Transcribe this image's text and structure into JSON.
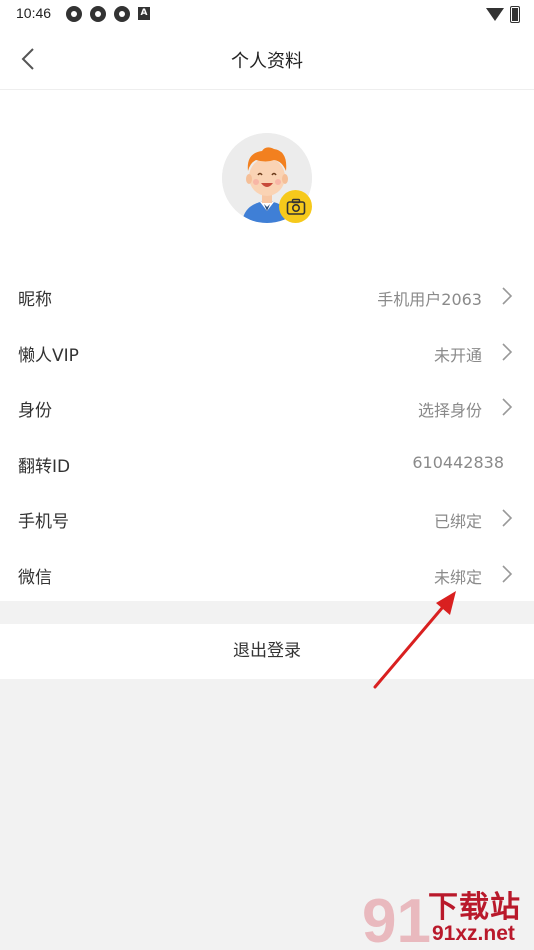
{
  "status_bar": {
    "time": "10:46",
    "badge_letter": "A"
  },
  "header": {
    "title": "个人资料"
  },
  "rows": [
    {
      "label": "昵称",
      "value": "手机用户2063",
      "arrow": true
    },
    {
      "label": "懒人VIP",
      "value": "未开通",
      "arrow": true
    },
    {
      "label": "身份",
      "value": "选择身份",
      "arrow": true
    },
    {
      "label": "翻转ID",
      "value": "610442838",
      "arrow": false
    },
    {
      "label": "手机号",
      "value": "已绑定",
      "arrow": true
    },
    {
      "label": "微信",
      "value": "未绑定",
      "arrow": true
    }
  ],
  "logout": {
    "label": "退出登录"
  },
  "watermark": {
    "brand": "下载站",
    "url": "91xz.net",
    "logo_mark": "91"
  },
  "colors": {
    "accent_yellow": "#f6c91b",
    "annotation_red": "#d92020",
    "watermark_red": "#b9192b"
  }
}
